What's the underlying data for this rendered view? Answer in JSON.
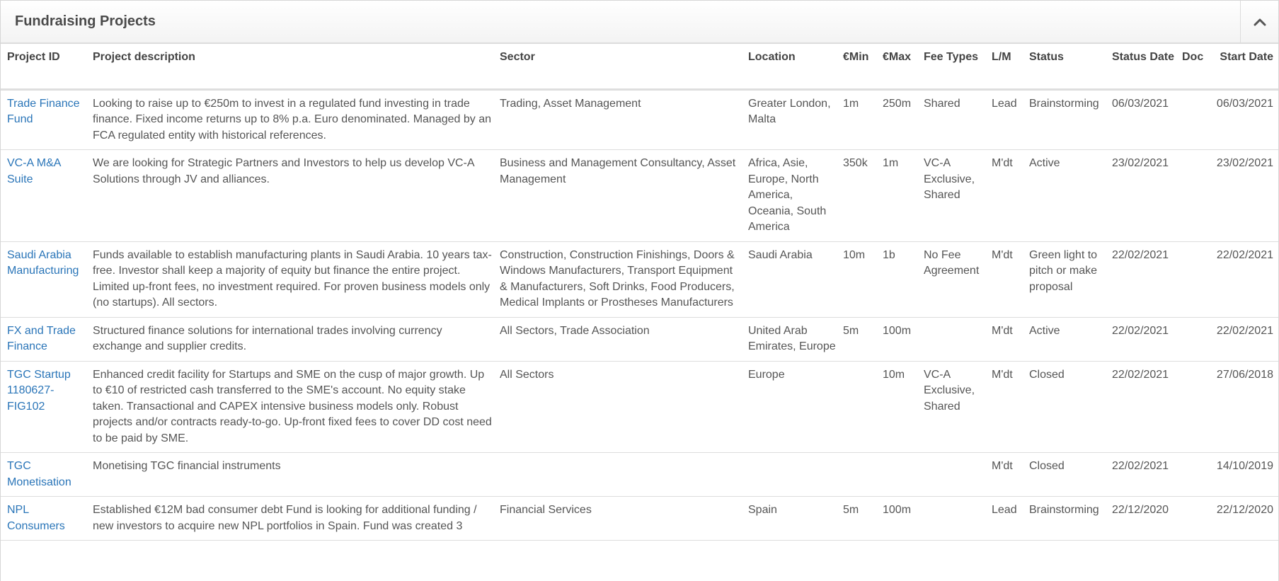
{
  "panel": {
    "title": "Fundraising Projects",
    "collapse_icon": "chevron-up-icon"
  },
  "table": {
    "columns": [
      "Project ID",
      "Project description",
      "Sector",
      "Location",
      "€Min",
      "€Max",
      "Fee Types",
      "L/M",
      "Status",
      "Status Date",
      "Doc",
      "Start Date"
    ],
    "rows": [
      {
        "id": "Trade Finance Fund",
        "description": "Looking to raise up to €250m to invest in a regulated fund investing in trade finance. Fixed income returns up to 8% p.a. Euro denominated. Managed by an FCA regulated entity with historical references.",
        "sector": "Trading, Asset Management",
        "location": "Greater London, Malta",
        "min": "1m",
        "max": "250m",
        "fee": "Shared",
        "lm": "Lead",
        "status": "Brainstorming",
        "status_date": "06/03/2021",
        "doc": "",
        "start_date": "06/03/2021"
      },
      {
        "id": "VC-A M&A Suite",
        "description": "We are looking for Strategic Partners and Investors to help us develop VC-A Solutions through JV and alliances.",
        "sector": "Business and Management Consultancy, Asset Management",
        "location": "Africa, Asie, Europe, North America, Oceania, South America",
        "min": "350k",
        "max": "1m",
        "fee": "VC-A Exclusive, Shared",
        "lm": "M'dt",
        "status": "Active",
        "status_date": "23/02/2021",
        "doc": "",
        "start_date": "23/02/2021"
      },
      {
        "id": "Saudi Arabia Manufacturing",
        "description": "Funds available to establish manufacturing plants in Saudi Arabia. 10 years tax-free. Investor shall keep a majority of equity but finance the entire project. Limited up-front fees, no investment required. For proven business models only (no startups). All sectors.",
        "sector": "Construction, Construction Finishings, Doors & Windows Manufacturers, Transport Equipment & Manufacturers, Soft Drinks, Food Producers, Medical Implants or Prostheses Manufacturers",
        "location": "Saudi Arabia",
        "min": "10m",
        "max": "1b",
        "fee": "No Fee Agreement",
        "lm": "M'dt",
        "status": "Green light to pitch or make proposal",
        "status_date": "22/02/2021",
        "doc": "",
        "start_date": "22/02/2021"
      },
      {
        "id": "FX and Trade Finance",
        "description": "Structured finance solutions for international trades involving currency exchange and supplier credits.",
        "sector": "All Sectors, Trade Association",
        "location": "United Arab Emirates, Europe",
        "min": "5m",
        "max": "100m",
        "fee": "",
        "lm": "M'dt",
        "status": "Active",
        "status_date": "22/02/2021",
        "doc": "",
        "start_date": "22/02/2021"
      },
      {
        "id": "TGC Startup 1180627-FIG102",
        "description": "Enhanced credit facility for Startups and SME on the cusp of major growth. Up to €10 of restricted cash transferred to the SME's account. No equity stake taken. Transactional and CAPEX intensive business models only. Robust projects and/or contracts ready-to-go. Up-front fixed fees to cover DD cost need to be paid by SME.",
        "sector": "All Sectors",
        "location": "Europe",
        "min": "",
        "max": "10m",
        "fee": "VC-A Exclusive, Shared",
        "lm": "M'dt",
        "status": "Closed",
        "status_date": "22/02/2021",
        "doc": "",
        "start_date": "27/06/2018"
      },
      {
        "id": "TGC Monetisation",
        "description": "Monetising TGC financial instruments",
        "sector": "",
        "location": "",
        "min": "",
        "max": "",
        "fee": "",
        "lm": "M'dt",
        "status": "Closed",
        "status_date": "22/02/2021",
        "doc": "",
        "start_date": "14/10/2019"
      },
      {
        "id": "NPL Consumers",
        "description": "Established €12M bad consumer debt Fund is looking for additional funding / new investors to acquire new NPL portfolios in Spain. Fund was created 3",
        "sector": "Financial Services",
        "location": "Spain",
        "min": "5m",
        "max": "100m",
        "fee": "",
        "lm": "Lead",
        "status": "Brainstorming",
        "status_date": "22/12/2020",
        "doc": "",
        "start_date": "22/12/2020"
      }
    ]
  }
}
